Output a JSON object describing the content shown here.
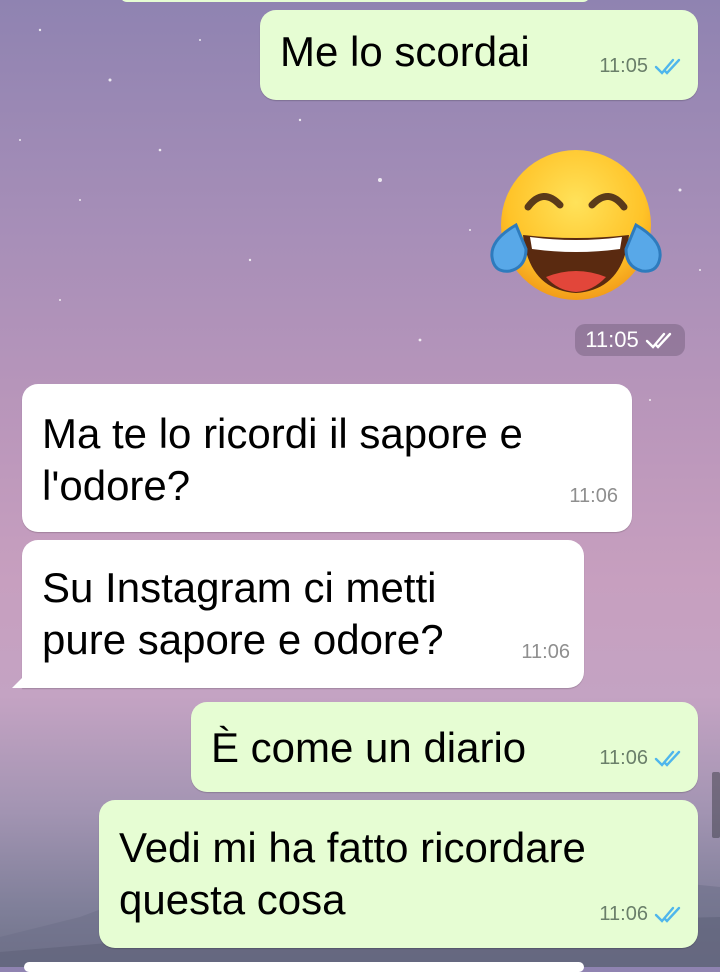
{
  "messages": [
    {
      "text": "Me lo scordai",
      "time": "11:05",
      "direction": "out",
      "status": "read"
    },
    {
      "emoji": "face-with-tears-of-joy",
      "time": "11:05",
      "direction": "out",
      "status": "read"
    },
    {
      "text": "Ma te lo ricordi il sapore e\nl'odore?",
      "time": "11:06",
      "direction": "in"
    },
    {
      "text": "Su Instagram ci metti\npure sapore e odore?",
      "time": "11:06",
      "direction": "in"
    },
    {
      "text": "È come un diario",
      "time": "11:06",
      "direction": "out",
      "status": "read"
    },
    {
      "text": "Vedi mi ha fatto ricordare\nquesta cosa",
      "time": "11:06",
      "direction": "out",
      "status": "read"
    }
  ],
  "colors": {
    "outgoing_bubble": "#e6fdd3",
    "incoming_bubble": "#ffffff",
    "read_tick": "#4fb6ec"
  }
}
